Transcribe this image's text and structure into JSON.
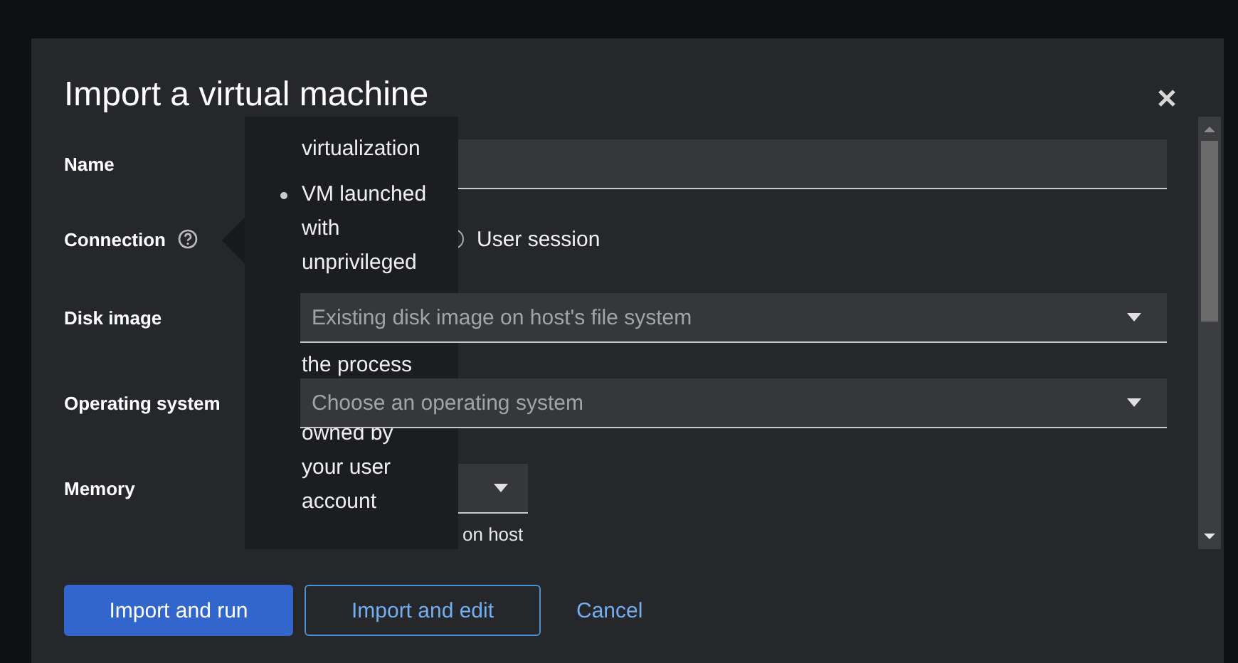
{
  "window": {
    "title": "Import a virtual machine"
  },
  "form": [
    {
      "kind": "text",
      "label": "Name"
    },
    {
      "kind": "radio",
      "label": "Connection",
      "help": true,
      "options": [
        {
          "label": "User session",
          "selected": false
        }
      ]
    },
    {
      "kind": "select",
      "label": "Disk image",
      "placeholder": "Existing disk image on host's file system"
    },
    {
      "kind": "select",
      "label": "Operating system",
      "placeholder": "Choose an operating system"
    },
    {
      "kind": "size",
      "label": "Memory",
      "helper": "on host"
    }
  ],
  "popover": {
    "items": [
      {
        "continued": true,
        "segments": [
          [
            "virtualization"
          ]
        ]
      },
      {
        "continued": false,
        "segments": [
          [
            "VM launched",
            "with",
            "unprivileged"
          ],
          [
            "the process"
          ],
          [
            "owned by",
            "your user",
            "account"
          ]
        ]
      }
    ]
  },
  "buttons": [
    {
      "kind": "primary",
      "label": "Import and run"
    },
    {
      "kind": "secondary",
      "label": "Import and edit"
    },
    {
      "kind": "link",
      "label": "Cancel"
    }
  ]
}
